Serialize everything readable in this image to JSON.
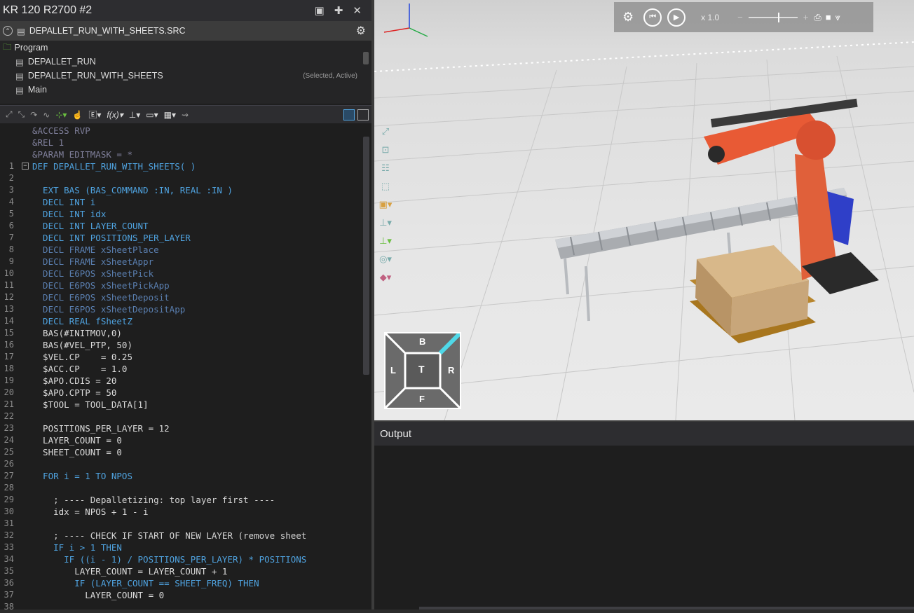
{
  "window": {
    "title": "KR 120 R2700 #2",
    "file_tab": "DEPALLET_RUN_WITH_SHEETS.SRC"
  },
  "tree": {
    "root": "Program",
    "items": [
      {
        "label": "DEPALLET_RUN",
        "status": ""
      },
      {
        "label": "DEPALLET_RUN_WITH_SHEETS",
        "status": "(Selected, Active)"
      },
      {
        "label": "Main",
        "status": ""
      }
    ]
  },
  "code": [
    {
      "n": "",
      "t": "&ACCESS RVP"
    },
    {
      "n": "",
      "t": "&REL 1"
    },
    {
      "n": "",
      "t": "&PARAM EDITMASK = *"
    },
    {
      "n": "1",
      "t": "DEF DEPALLET_RUN_WITH_SHEETS( )"
    },
    {
      "n": "2",
      "t": ""
    },
    {
      "n": "3",
      "t": "  EXT BAS (BAS_COMMAND :IN, REAL :IN )"
    },
    {
      "n": "4",
      "t": "  DECL INT i"
    },
    {
      "n": "5",
      "t": "  DECL INT idx"
    },
    {
      "n": "6",
      "t": "  DECL INT LAYER_COUNT"
    },
    {
      "n": "7",
      "t": "  DECL INT POSITIONS_PER_LAYER"
    },
    {
      "n": "8",
      "t": "  DECL FRAME xSheetPlace"
    },
    {
      "n": "9",
      "t": "  DECL FRAME xSheetAppr"
    },
    {
      "n": "10",
      "t": "  DECL E6POS xSheetPick"
    },
    {
      "n": "11",
      "t": "  DECL E6POS xSheetPickApp"
    },
    {
      "n": "12",
      "t": "  DECL E6POS xSheetDeposit"
    },
    {
      "n": "13",
      "t": "  DECL E6POS xSheetDepositApp"
    },
    {
      "n": "14",
      "t": "  DECL REAL fSheetZ"
    },
    {
      "n": "15",
      "t": "  BAS(#INITMOV,0)"
    },
    {
      "n": "16",
      "t": "  BAS(#VEL_PTP, 50)"
    },
    {
      "n": "17",
      "t": "  $VEL.CP    = 0.25"
    },
    {
      "n": "18",
      "t": "  $ACC.CP    = 1.0"
    },
    {
      "n": "19",
      "t": "  $APO.CDIS = 20"
    },
    {
      "n": "20",
      "t": "  $APO.CPTP = 50"
    },
    {
      "n": "21",
      "t": "  $TOOL = TOOL_DATA[1]"
    },
    {
      "n": "22",
      "t": ""
    },
    {
      "n": "23",
      "t": "  POSITIONS_PER_LAYER = 12"
    },
    {
      "n": "24",
      "t": "  LAYER_COUNT = 0"
    },
    {
      "n": "25",
      "t": "  SHEET_COUNT = 0"
    },
    {
      "n": "26",
      "t": ""
    },
    {
      "n": "27",
      "t": "  FOR i = 1 TO NPOS"
    },
    {
      "n": "28",
      "t": ""
    },
    {
      "n": "29",
      "t": "    ; ---- Depalletizing: top layer first ----"
    },
    {
      "n": "30",
      "t": "    idx = NPOS + 1 - i"
    },
    {
      "n": "31",
      "t": ""
    },
    {
      "n": "32",
      "t": "    ; ---- CHECK IF START OF NEW LAYER (remove sheet"
    },
    {
      "n": "33",
      "t": "    IF i > 1 THEN"
    },
    {
      "n": "34",
      "t": "      IF ((i - 1) / POSITIONS_PER_LAYER) * POSITIONS"
    },
    {
      "n": "35",
      "t": "        LAYER_COUNT = LAYER_COUNT + 1"
    },
    {
      "n": "36",
      "t": "        IF (LAYER_COUNT == SHEET_FREQ) THEN"
    },
    {
      "n": "37",
      "t": "          LAYER_COUNT = 0"
    },
    {
      "n": "38",
      "t": ""
    }
  ],
  "playbar": {
    "speed": "x  1.0"
  },
  "viewcube": {
    "top": "T",
    "back": "B",
    "front": "F",
    "left": "L",
    "right": "R"
  },
  "output": {
    "title": "Output"
  }
}
